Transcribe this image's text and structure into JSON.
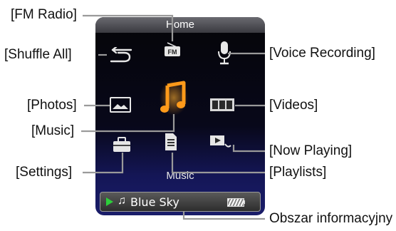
{
  "screen": {
    "title": "Home",
    "caption": "Music",
    "info_bar": {
      "track_title": "Blue Sky",
      "note_glyph": "♫"
    }
  },
  "icons": [
    "fm-radio-icon",
    "shuffle-icon",
    "microphone-icon",
    "photo-icon",
    "music-note-icon",
    "film-icon",
    "toolbox-icon",
    "playlist-file-icon",
    "now-playing-icon",
    "play-triangle-icon",
    "battery-icon"
  ],
  "callouts": {
    "fm_radio": "[FM Radio]",
    "shuffle_all": "[Shuffle All]",
    "voice_recording": "[Voice Recording]",
    "photos": "[Photos]",
    "videos": "[Videos]",
    "music": "[Music]",
    "now_playing": "[Now Playing]",
    "settings": "[Settings]",
    "playlists": "[Playlists]",
    "info_area": "Obszar informacyjny"
  },
  "colors": {
    "music_accent": "#ff9a1a",
    "play_green": "#2ccf3a",
    "screen_bg": "#08081a"
  }
}
